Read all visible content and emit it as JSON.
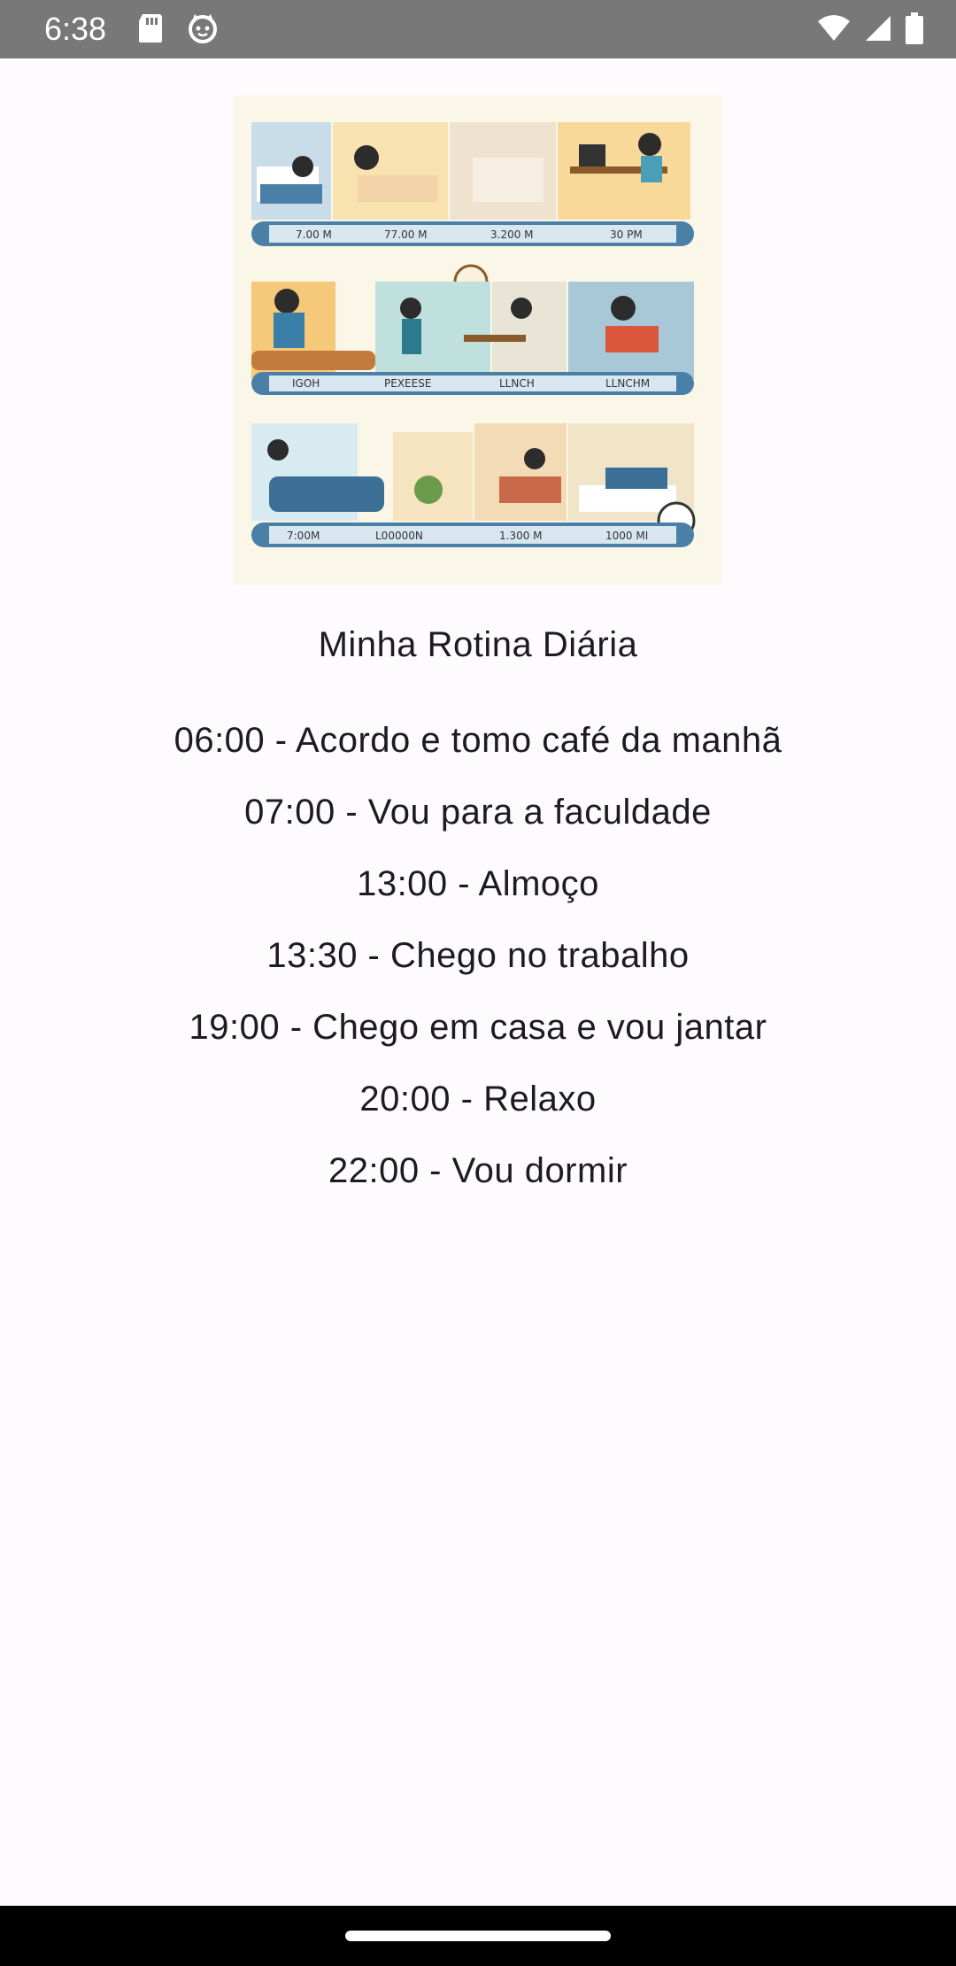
{
  "status_bar": {
    "time": "6:38",
    "left_icons": [
      "sd-card-icon",
      "cat-face-icon"
    ],
    "right_icons": [
      "wifi-icon",
      "signal-icon",
      "battery-icon"
    ]
  },
  "main": {
    "illustration": {
      "description_icon": "daily-routine-illustration",
      "timeline_labels_row1": [
        "7.00 M",
        "77.00 M",
        "3.200 M",
        "30 PM"
      ],
      "timeline_labels_row2": [
        "IGOH",
        "PEXEESE",
        "LLNCH",
        "LLNCHM"
      ],
      "timeline_labels_row3": [
        "7:00M",
        "L00000N",
        "1.300 M",
        "1000 MI"
      ]
    },
    "title": "Minha Rotina Diária",
    "routine": [
      "06:00 - Acordo e tomo café da manhã",
      "07:00 - Vou para a faculdade",
      "13:00 - Almoço",
      "13:30 - Chego no trabalho",
      "19:00 - Chego em casa e vou jantar",
      "20:00 - Relaxo",
      "22:00 - Vou dormir"
    ]
  },
  "colors": {
    "status_bar": "#787878",
    "background": "#fdfbfe",
    "text": "#1d1b20",
    "nav_bar": "#000000"
  }
}
